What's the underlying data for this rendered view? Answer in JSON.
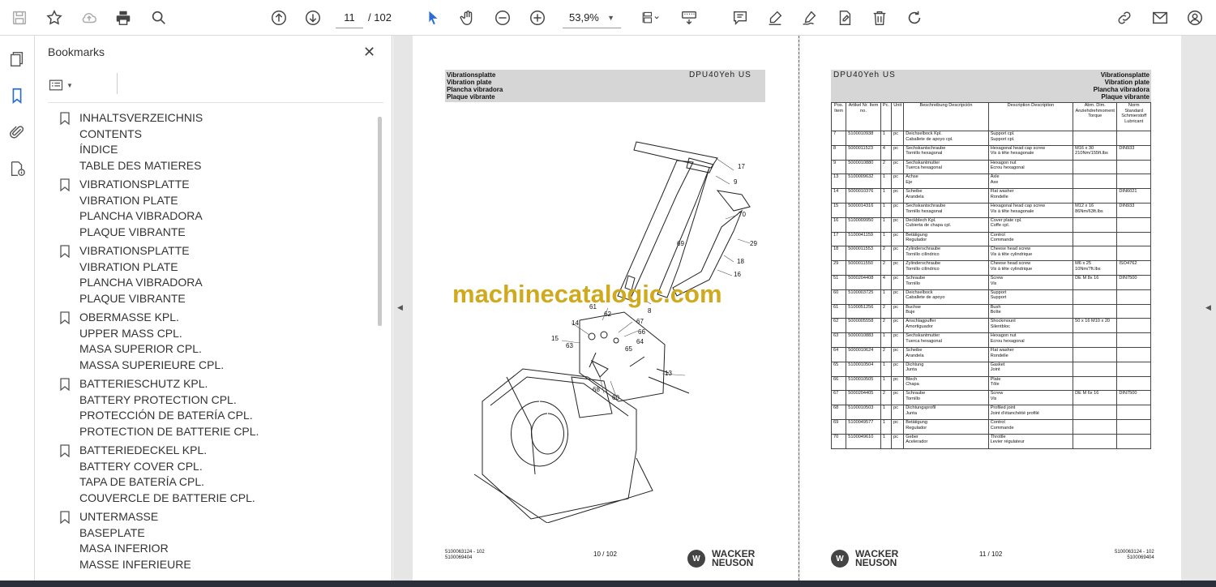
{
  "toolbar": {
    "current_page": "11",
    "page_separator": "/",
    "total_pages": "102",
    "zoom": "53,9%"
  },
  "bookmarks_panel": {
    "title": "Bookmarks",
    "close_label": "✕",
    "items": [
      {
        "lines": [
          "INHALTSVERZEICHNIS",
          "CONTENTS",
          "ÍNDICE",
          "TABLE DES MATIERES"
        ]
      },
      {
        "lines": [
          "VIBRATIONSPLATTE",
          "VIBRATION PLATE",
          "PLANCHA VIBRADORA",
          "PLAQUE VIBRANTE"
        ]
      },
      {
        "lines": [
          "VIBRATIONSPLATTE",
          "VIBRATION PLATE",
          "PLANCHA VIBRADORA",
          "PLAQUE VIBRANTE"
        ]
      },
      {
        "lines": [
          "OBERMASSE KPL.",
          "UPPER MASS CPL.",
          "MASA SUPERIOR CPL.",
          "MASSA SUPERIEURE CPL."
        ]
      },
      {
        "lines": [
          "BATTERIESCHUTZ KPL.",
          "BATTERY PROTECTION CPL.",
          "PROTECCIÓN DE BATERÍA CPL.",
          "PROTECTION DE BATTERIE CPL."
        ]
      },
      {
        "lines": [
          "BATTERIEDECKEL KPL.",
          "BATTERY COVER CPL.",
          "TAPA DE BATERÍA CPL.",
          "COUVERCLE DE BATTERIE CPL."
        ]
      },
      {
        "lines": [
          "UNTERMASSE",
          "BASEPLATE",
          "MASA INFERIOR",
          "MASSE INFERIEURE"
        ]
      }
    ]
  },
  "left_page": {
    "header_lines": [
      "Vibrationsplatte",
      "Vibration plate",
      "Plancha vibradora",
      "Plaque vibrante"
    ],
    "model": "DPU40Yeh US",
    "callouts": [
      "17",
      "9",
      "70",
      "29",
      "18",
      "16",
      "69",
      "8",
      "61",
      "62",
      "14",
      "15",
      "63",
      "67",
      "66",
      "64",
      "65",
      "13",
      "68",
      "60"
    ],
    "footer_doc": "5100063124 - 102",
    "footer_doc2": "5100069404",
    "page_label": "10 / 102",
    "brand_line1": "WACKER",
    "brand_line2": "NEUSON",
    "brand_mark": "W"
  },
  "right_page": {
    "header_lines": [
      "Vibrationsplatte",
      "Vibration plate",
      "Plancha vibradora",
      "Plaque vibrante"
    ],
    "model": "DPU40Yeh US",
    "table_headers": [
      "Pos. Item",
      "Artikel Nr. Item no.",
      "Pc.",
      "Unit",
      "Beschreibung Descripción",
      "Description Description",
      "Abm. Dim. Anziehdrehmoment Torque",
      "Norm Standard Schmierstoff Lubricant"
    ],
    "rows": [
      [
        "7",
        "5100010938",
        "1",
        "pc",
        "Deichselbock Kpl.\nCaballete de apoyo cpl.",
        "Support cpl.\nSupport cpl.",
        "",
        ""
      ],
      [
        "8",
        "5000011523",
        "4",
        "pc",
        "Sechskantschraube\nTornillo hexagonal",
        "Hexagonal head cap screw\nVis à tête hexagonale",
        "M16 x 30\n210Nm/155ft.lbs",
        "DIN933"
      ],
      [
        "9",
        "5000010880",
        "2",
        "pc",
        "Sechskantmutter\nTuerca hexagonal",
        "Hexagon nut\nEcrou hexagonal",
        "",
        ""
      ],
      [
        "13",
        "5100009632",
        "1",
        "pc",
        "Achse\nEje",
        "Axle\nAxe",
        "",
        ""
      ],
      [
        "14",
        "5000010376",
        "1",
        "pc",
        "Scheibe\nArandela",
        "Flat washer\nRondelle",
        "",
        "DIN6021"
      ],
      [
        "15",
        "5000014316",
        "1",
        "pc",
        "Sechskantschraube\nTornillo hexagonal",
        "Hexagonal head cap screw\nVis à tête hexagonale",
        "M12 x 16\n86Nm/63ft.lbs",
        "DIN933"
      ],
      [
        "16",
        "5100009950",
        "1",
        "pc",
        "Deckblech Kpl.\nCubierta de chapa cpl.",
        "Cover plate cpl.\nCoffe cpl.",
        "",
        ""
      ],
      [
        "17",
        "5100041159",
        "1",
        "pc",
        "Betätigung\nRegulador",
        "Control\nCommande",
        "",
        ""
      ],
      [
        "18",
        "5000011553",
        "2",
        "pc",
        "Zylinderschraube\nTornillo cilíndrico",
        "Cheese head screw\nVis à tête cylindrique",
        "",
        ""
      ],
      [
        "29",
        "5000011550",
        "2",
        "pc",
        "Zylinderschraube\nTornillo cilíndrico",
        "Cheese head screw\nVis à tête cylindrique",
        "M6 x 25\n10Nm/7ft.lbs",
        "ISO4762"
      ],
      [
        "51",
        "5000204408",
        "4",
        "pc",
        "Schraube\nTornillo",
        "Screw\nVis",
        "DE M 8x 16",
        "DIN7500"
      ],
      [
        "60",
        "5100003725",
        "1",
        "pc",
        "Deichselbock\nCaballete de apoyo",
        "Support\nSupport",
        "",
        ""
      ],
      [
        "61",
        "5100051256",
        "2",
        "pc",
        "Buchse\nBuje",
        "Bush\nBoîte",
        "",
        ""
      ],
      [
        "62",
        "5000005558",
        "2",
        "pc",
        "Anschlagpuffer\nAmortiguador",
        "Shockmount\nSilentbloc",
        "50 x 16 M10 x 20",
        ""
      ],
      [
        "63",
        "5000010883",
        "1",
        "pc",
        "Sechskantmutter\nTuerca hexagonal",
        "Hexagon nut\nEcrou hexagonal",
        "",
        ""
      ],
      [
        "64",
        "5000010624",
        "2",
        "pc",
        "Scheibe\nArandela",
        "Flat washer\nRondelle",
        "",
        ""
      ],
      [
        "65",
        "5100010504",
        "1",
        "pc",
        "Dichtung\nJunta",
        "Gasket\nJoint",
        "",
        ""
      ],
      [
        "66",
        "5100010505",
        "1",
        "pc",
        "Blech\nChapa",
        "Plate\nTôle",
        "",
        ""
      ],
      [
        "67",
        "5000204405",
        "2",
        "pc",
        "Schraube\nTornillo",
        "Screw\nVis",
        "DE M 6x 16",
        "DIN7500"
      ],
      [
        "68",
        "5100010503",
        "1",
        "pc",
        "Dichtungsprofil\nJunta",
        "Profiled joint\nJoint d'étanchéité profilé",
        "",
        ""
      ],
      [
        "69",
        "5100049577",
        "1",
        "pc",
        "Betätigung\nRegulador",
        "Control\nCommande",
        "",
        ""
      ],
      [
        "70",
        "5100049610",
        "1",
        "pc",
        "Geber\nAcelerador",
        "Throttle\nLevier régulateur",
        "",
        ""
      ]
    ],
    "footer_doc": "5100063124 - 102",
    "footer_doc2": "5100069404",
    "page_label": "11 / 102",
    "brand_line1": "WACKER",
    "brand_line2": "NEUSON",
    "brand_mark": "W"
  },
  "watermark": "machinecatalogic.com",
  "icons": [
    "save-icon",
    "star-icon",
    "upload-cloud-icon",
    "print-icon",
    "zoom-search-icon",
    "page-up-icon",
    "page-down-icon",
    "select-arrow-icon",
    "hand-icon",
    "zoom-out-icon",
    "zoom-in-icon",
    "page-fit-icon",
    "keyboard-scroll-icon",
    "comment-icon",
    "highlight-pen-icon",
    "sign-icon",
    "stamp-icon",
    "trash-icon",
    "rotate-icon",
    "link-icon",
    "mail-icon",
    "user-icon",
    "pages-icon",
    "bookmark-icon",
    "attachment-icon",
    "doc-info-icon",
    "bookmark-options-icon"
  ]
}
